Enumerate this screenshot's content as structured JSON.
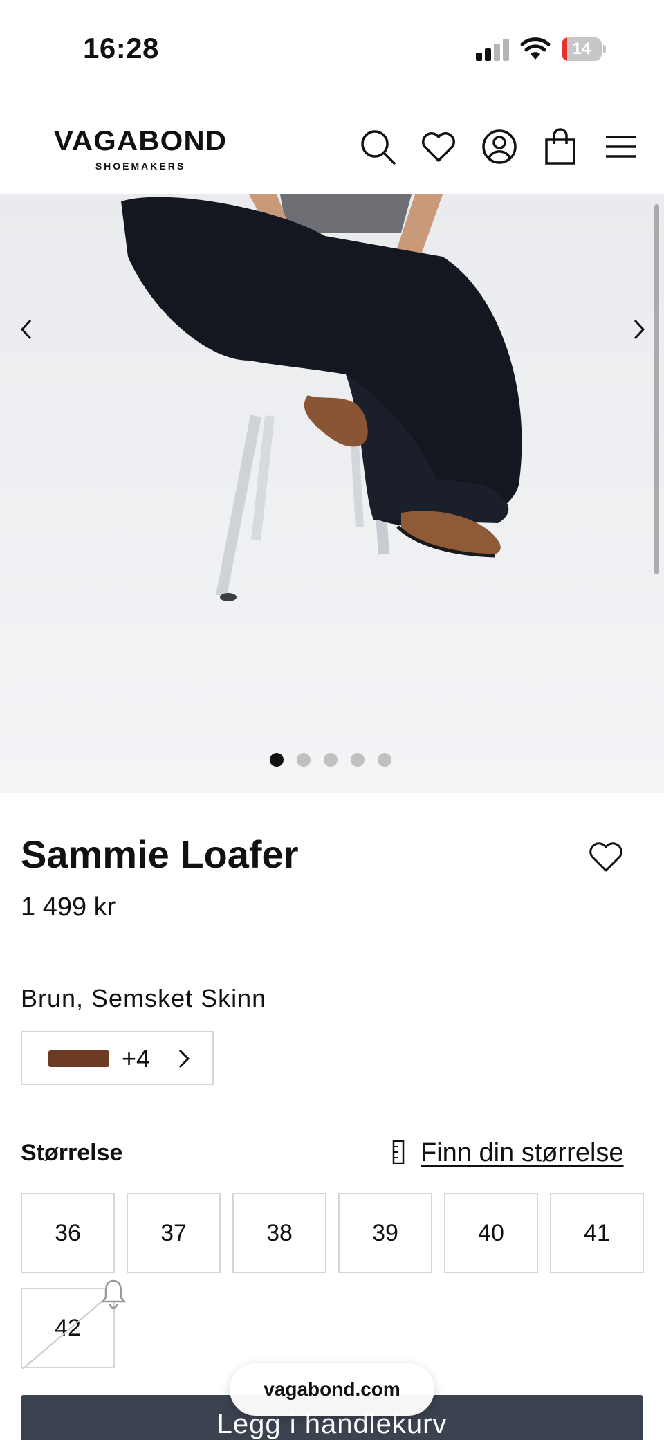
{
  "status_bar": {
    "time": "16:28",
    "battery_level": "14",
    "battery_fraction": 0.14,
    "signal_bars": 2,
    "signal_bars_total": 4
  },
  "header": {
    "logo_main": "VAGABOND",
    "logo_sub": "SHOEMAKERS",
    "icons": [
      "search-icon",
      "heart-icon",
      "account-icon",
      "shopping-bag-icon",
      "menu-icon"
    ]
  },
  "carousel": {
    "image_count": 5,
    "active_index": 0,
    "prev_icon": "chevron-left-icon",
    "next_icon": "chevron-right-icon"
  },
  "product": {
    "title": "Sammie Loafer",
    "price": "1 499 kr",
    "color_name": "Brun, Semsket Skinn",
    "color_swatch": "#6b3b23",
    "more_colors": "+4"
  },
  "sizes": {
    "label": "Størrelse",
    "guide_link": "Finn din størrelse",
    "options": [
      {
        "label": "36",
        "available": true
      },
      {
        "label": "37",
        "available": true
      },
      {
        "label": "38",
        "available": true
      },
      {
        "label": "39",
        "available": true
      },
      {
        "label": "40",
        "available": true
      },
      {
        "label": "41",
        "available": true
      },
      {
        "label": "42",
        "available": false
      }
    ]
  },
  "footer": {
    "add_to_cart": "Legg i handlekurv",
    "url": "vagabond.com"
  },
  "colors": {
    "button_bg": "#3b4250",
    "battery_low": "#e5322f",
    "dot_active": "#111111",
    "dot_inactive": "#c0c0c0"
  }
}
